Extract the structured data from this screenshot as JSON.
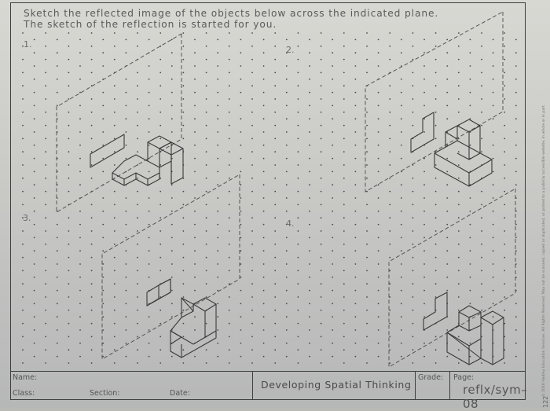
{
  "worksheet": {
    "instructions": [
      "Sketch the reflected image of the objects below across the indicated plane.",
      "The sketch of the reflection is started for you."
    ],
    "problems": [
      {
        "label": "1."
      },
      {
        "label": "2."
      },
      {
        "label": "3."
      },
      {
        "label": "4."
      }
    ]
  },
  "title_block": {
    "name_label": "Name:",
    "class_label": "Class:",
    "section_label": "Section:",
    "date_label": "Date:",
    "course_title": "Developing Spatial Thinking",
    "grade_label": "Grade:",
    "page_label": "Page:",
    "page_code": "reflx/sym–08"
  },
  "side_margin": {
    "copyright": "© 2018 Hadley Education Services. All Rights Reserved. May not be scanned, copied or duplicated, or posted to a publicly accessible website, in whole or in part.",
    "page_number": "122"
  },
  "colors": {
    "ink": "#3e3e3e",
    "paper": "#cfcfcb",
    "dots": "#4a4a4a"
  }
}
